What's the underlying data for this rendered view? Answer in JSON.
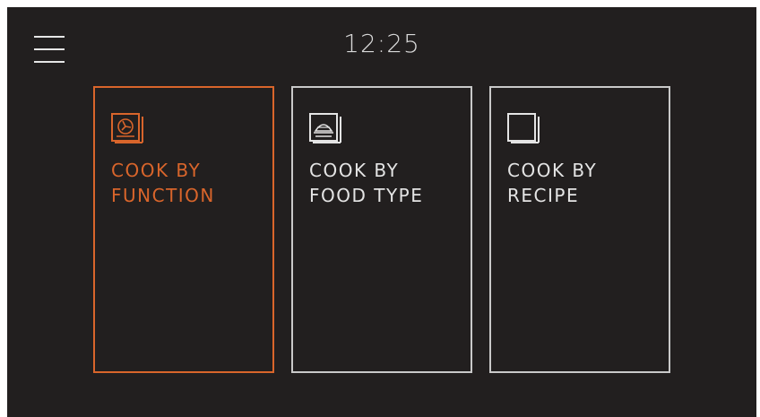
{
  "header": {
    "time": "12:25"
  },
  "colors": {
    "accent": "#d9652b",
    "background": "#221f1f",
    "tile_border": "#c9c9c9",
    "text": "#e4e4e4"
  },
  "tiles": [
    {
      "label": "COOK BY\nFUNCTION",
      "icon": "oven-fan-icon",
      "selected": true
    },
    {
      "label": "COOK BY\nFOOD TYPE",
      "icon": "food-cloche-icon",
      "selected": false
    },
    {
      "label": "COOK BY\nRECIPE",
      "icon": "recipe-book-icon",
      "selected": false
    }
  ]
}
